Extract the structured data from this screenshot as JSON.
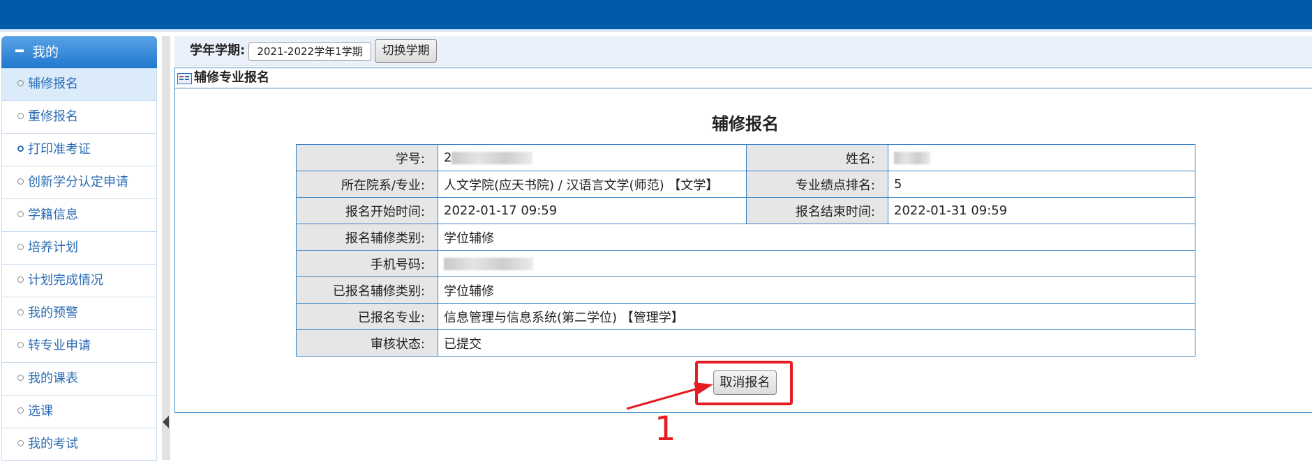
{
  "sidebar": {
    "header": "我的",
    "items": [
      {
        "label": "辅修报名"
      },
      {
        "label": "重修报名"
      },
      {
        "label": "打印准考证"
      },
      {
        "label": "创新学分认定申请"
      },
      {
        "label": "学籍信息"
      },
      {
        "label": "培养计划"
      },
      {
        "label": "计划完成情况"
      },
      {
        "label": "我的预警"
      },
      {
        "label": "转专业申请"
      },
      {
        "label": "我的课表"
      },
      {
        "label": "选课"
      },
      {
        "label": "我的考试"
      }
    ]
  },
  "term": {
    "label": "学年学期:",
    "selected": "2021-2022学年1学期",
    "switch_button": "切换学期"
  },
  "panel": {
    "title": "辅修专业报名"
  },
  "form": {
    "title": "辅修报名",
    "student_id_label": "学号:",
    "student_id_value": "2",
    "name_label": "姓名:",
    "dept_label": "所在院系/专业:",
    "dept_value": "人文学院(应天书院) / 汉语言文学(师范) 【文学】",
    "rank_label": "专业绩点排名:",
    "rank_value": "5",
    "start_label": "报名开始时间:",
    "start_value": "2022-01-17 09:59",
    "end_label": "报名结束时间:",
    "end_value": "2022-01-31 09:59",
    "category_label": "报名辅修类别:",
    "category_value": "学位辅修",
    "phone_label": "手机号码:",
    "registered_category_label": "已报名辅修类别:",
    "registered_category_value": "学位辅修",
    "registered_major_label": "已报名专业:",
    "registered_major_value": "信息管理与信息系统(第二学位) 【管理学】",
    "status_label": "审核状态:",
    "status_value": "已提交",
    "cancel_button": "取消报名"
  },
  "annotation": {
    "step_number": "1",
    "color": "#e51c23"
  },
  "colors": {
    "topbar": "#005bac",
    "accent": "#2a6bb5",
    "border": "#3a86c8"
  }
}
